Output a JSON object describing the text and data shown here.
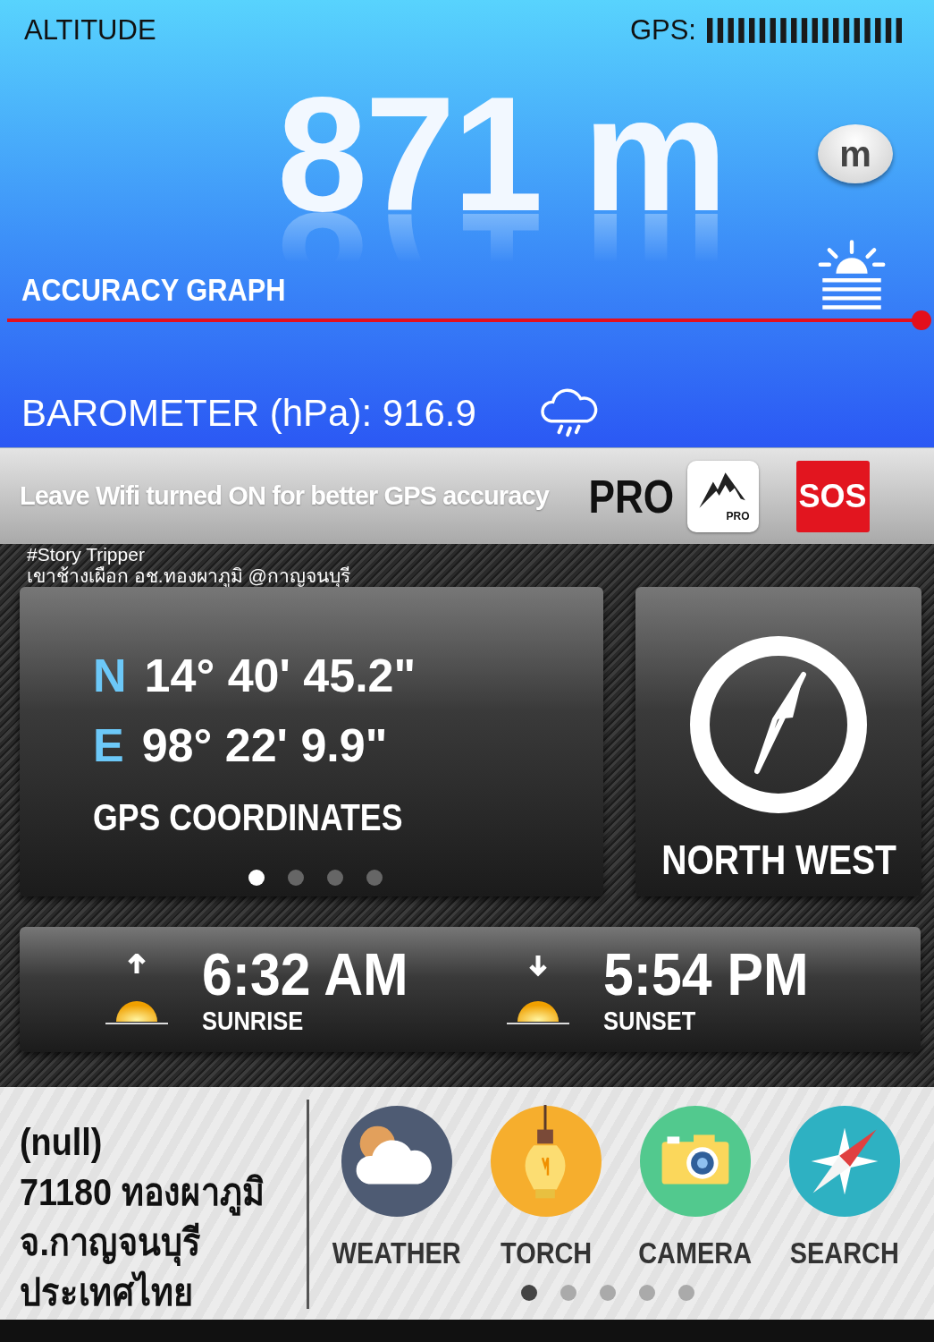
{
  "header": {
    "title": "ALTITUDE",
    "gps_label": "GPS:"
  },
  "altitude": {
    "value": "871 m",
    "unit_button": "m"
  },
  "accuracy_graph": {
    "label": "ACCURACY GRAPH",
    "level": 1
  },
  "barometer": {
    "label": "BAROMETER (hPa): 916.9"
  },
  "banner": {
    "text": "Leave Wifi turned ON for better GPS accuracy",
    "pro": "PRO",
    "pro_badge": "PRO",
    "sos": "SOS"
  },
  "caption": {
    "lines": [
      "#Story Tripper",
      "เขาช้างเผือก อช.ทองผาภูมิ @กาญจนบุรี"
    ]
  },
  "coordinates": {
    "rows": [
      {
        "axis": "N",
        "value": "14° 40' 45.2\""
      },
      {
        "axis": "E",
        "value": "98° 22' 9.9\""
      }
    ],
    "label": "GPS COORDINATES",
    "pages": [
      {
        "selected": true
      },
      {
        "selected": false
      },
      {
        "selected": false
      },
      {
        "selected": false
      }
    ]
  },
  "compass": {
    "direction": "NORTH WEST"
  },
  "sun": [
    {
      "kind": "rise",
      "time": "6:32 AM",
      "label": "SUNRISE"
    },
    {
      "kind": "set",
      "time": "5:54 PM",
      "label": "SUNSET"
    }
  ],
  "location": {
    "lines": [
      "(null)",
      "71180 ทองผาภูมิ",
      "จ.กาญจนบุรี",
      "ประเทศไทย"
    ]
  },
  "apps": [
    {
      "kind": "weather",
      "label": "WEATHER"
    },
    {
      "kind": "torch",
      "label": "TORCH"
    },
    {
      "kind": "camera",
      "label": "CAMERA"
    },
    {
      "kind": "search",
      "label": "SEARCH"
    }
  ],
  "app_pages": [
    {
      "selected": true
    },
    {
      "selected": false
    },
    {
      "selected": false
    },
    {
      "selected": false
    },
    {
      "selected": false
    }
  ]
}
